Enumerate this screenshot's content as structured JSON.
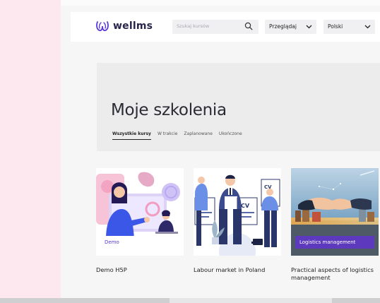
{
  "header": {
    "logo_text": "wellms",
    "search_placeholder": "Szukaj kursów",
    "browse_label": "Przeglądaj",
    "language_label": "Polski"
  },
  "page": {
    "title": "Moje szkolenia",
    "tabs": [
      {
        "label": "Wszystkie kursy",
        "active": true
      },
      {
        "label": "W trakcie"
      },
      {
        "label": "Zaplanowane"
      },
      {
        "label": "Ukończone"
      }
    ]
  },
  "courses": [
    {
      "title": "Demo H5P",
      "category": "Demo"
    },
    {
      "title": "Labour market in Poland",
      "category": ""
    },
    {
      "title": "Practical aspects of logistics management",
      "category": "Logistics management"
    }
  ],
  "colors": {
    "brand": "#5a39d8",
    "background_pink": "#fde8ef"
  }
}
